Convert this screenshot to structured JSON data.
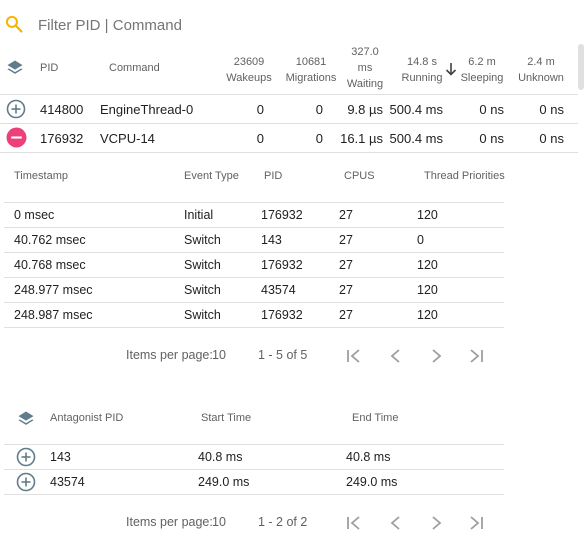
{
  "filter": {
    "placeholder": "Filter PID | Command"
  },
  "main_table": {
    "columns": {
      "pid": "PID",
      "command": "Command",
      "wakeups": {
        "value": "23609",
        "label": "Wakeups"
      },
      "migrations": {
        "value": "10681",
        "label": "Migrations"
      },
      "waiting": {
        "value": "327.0",
        "unit": "ms",
        "label": "Waiting"
      },
      "running": {
        "value": "14.8 s",
        "label": "Running"
      },
      "sleeping": {
        "value": "6.2 m",
        "label": "Sleeping"
      },
      "unknown": {
        "value": "2.4 m",
        "label": "Unknown"
      }
    },
    "rows": [
      {
        "pid": "414800",
        "command": "EngineThread-0",
        "wakeups": "0",
        "migrations": "0",
        "waiting": "9.8 µs",
        "running": "500.4 ms",
        "sleeping": "0 ns",
        "unknown": "0 ns",
        "expanded": false
      },
      {
        "pid": "176932",
        "command": "VCPU-14",
        "wakeups": "0",
        "migrations": "0",
        "waiting": "16.1 µs",
        "running": "500.4 ms",
        "sleeping": "0 ns",
        "unknown": "0 ns",
        "expanded": true
      }
    ]
  },
  "events_table": {
    "columns": {
      "timestamp": "Timestamp",
      "event_type": "Event Type",
      "pid": "PID",
      "cpus": "CPUS",
      "thread_priorities": "Thread Priorities"
    },
    "rows": [
      {
        "timestamp": "0 msec",
        "event_type": "Initial",
        "pid": "176932",
        "cpus": "27",
        "priority": "120"
      },
      {
        "timestamp": "40.762 msec",
        "event_type": "Switch",
        "pid": "143",
        "cpus": "27",
        "priority": "0"
      },
      {
        "timestamp": "40.768 msec",
        "event_type": "Switch",
        "pid": "176932",
        "cpus": "27",
        "priority": "120"
      },
      {
        "timestamp": "248.977 msec",
        "event_type": "Switch",
        "pid": "43574",
        "cpus": "27",
        "priority": "120"
      },
      {
        "timestamp": "248.987 msec",
        "event_type": "Switch",
        "pid": "176932",
        "cpus": "27",
        "priority": "120"
      }
    ],
    "paginator": {
      "items_label": "Items per page:",
      "page_size": "10",
      "range": "1 - 5 of 5"
    }
  },
  "antagonist_table": {
    "columns": {
      "antagonist_pid": "Antagonist PID",
      "start_time": "Start Time",
      "end_time": "End Time"
    },
    "rows": [
      {
        "pid": "143",
        "start": "40.8 ms",
        "end": "40.8 ms"
      },
      {
        "pid": "43574",
        "start": "249.0 ms",
        "end": "249.0 ms"
      }
    ],
    "paginator": {
      "items_label": "Items per page:",
      "page_size": "10",
      "range": "1 - 2 of 2"
    }
  },
  "colors": {
    "accent_yellow": "#f4b400",
    "collapse_pink": "#ec407a",
    "icon_gray": "#607d8b"
  }
}
